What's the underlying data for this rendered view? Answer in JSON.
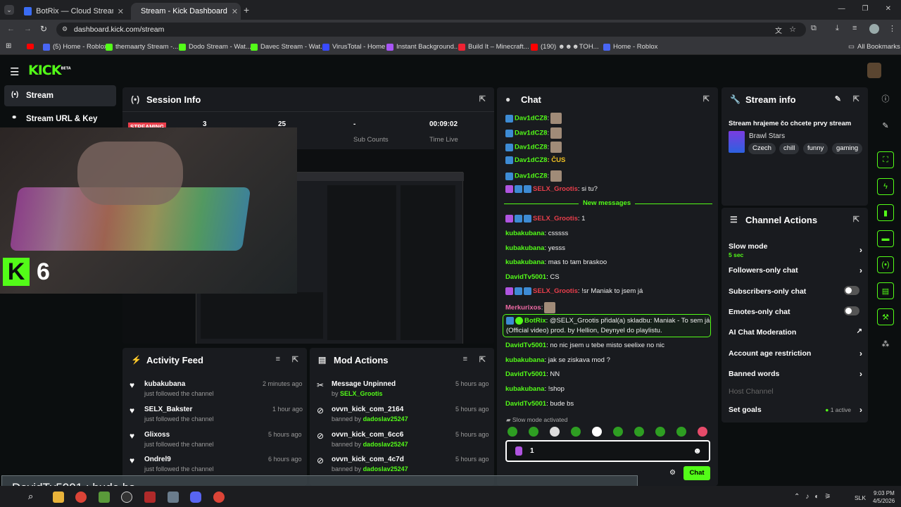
{
  "browser": {
    "tabs": [
      {
        "title": "BotRix — Cloud Streaming Bo"
      },
      {
        "title": "Stream - Kick Dashboard"
      }
    ],
    "url": "dashboard.kick.com/stream",
    "bookmarks": [
      "(5) Home - Roblox",
      "themaarty Stream -...",
      "Dodo Stream - Wat...",
      "Davec Stream - Wat...",
      "VirusTotal - Home",
      "Instant Background...",
      "Build It – Minecraft...",
      "(190) ☻☻☻TOH...",
      "Home - Roblox"
    ],
    "all_bookmarks": "All Bookmarks"
  },
  "brand": {
    "logo": "KICK",
    "beta": "BETA"
  },
  "nav": {
    "stream": "Stream",
    "stream_url_key": "Stream URL & Key"
  },
  "session": {
    "title": "Session Info",
    "status": "STREAMING",
    "viewers": "3",
    "followers_value": "25",
    "followers_label": "wers",
    "sub_value": "-",
    "sub_label": "Sub Counts",
    "time_value": "00:09:02",
    "time_label": "Time Live"
  },
  "overlay": {
    "counter": "6"
  },
  "activity": {
    "title": "Activity Feed",
    "items": [
      {
        "name": "kubakubana",
        "sub": "just followed the channel",
        "time": "2 minutes ago"
      },
      {
        "name": "SELX_Bakster",
        "sub": "just followed the channel",
        "time": "1 hour ago"
      },
      {
        "name": "Glixoss",
        "sub": "just followed the channel",
        "time": "5 hours ago"
      },
      {
        "name": "Ondrel9",
        "sub": "just followed the channel",
        "time": "6 hours ago"
      }
    ]
  },
  "mod": {
    "title": "Mod Actions",
    "items": [
      {
        "name": "Message Unpinned",
        "by": "by",
        "user": "SELX_Grootis",
        "time": "5 hours ago"
      },
      {
        "name": "ovvn_kick_com_2164",
        "by": "banned by",
        "user": "dadoslav25247",
        "time": "5 hours ago"
      },
      {
        "name": "ovvn_kick_com_6cc6",
        "by": "banned by",
        "user": "dadoslav25247",
        "time": "5 hours ago"
      },
      {
        "name": "ovvn_kick_com_4c7d",
        "by": "banned by",
        "user": "dadoslav25247",
        "time": "5 hours ago"
      }
    ]
  },
  "chat": {
    "title": "Chat",
    "messages": [
      {
        "user": "Dav1dCZ8",
        "text": ":",
        "color": "green"
      },
      {
        "user": "Dav1dCZ8",
        "text": ":",
        "color": "green"
      },
      {
        "user": "Dav1dCZ8",
        "text": ":",
        "color": "green"
      },
      {
        "user": "Dav1dCZ8",
        "text": ": ČUS",
        "color": "green"
      },
      {
        "user": "Dav1dCZ8",
        "text": ":",
        "color": "green"
      },
      {
        "user": "SELX_Grootis",
        "text": ": si tu?",
        "color": "red"
      }
    ],
    "new_messages": "New messages",
    "messages2": [
      {
        "user": "SELX_Grootis",
        "text": ": 1",
        "color": "red"
      },
      {
        "user": "kubakubana",
        "text": ": csssss",
        "color": "green"
      },
      {
        "user": "kubakubana",
        "text": ": yesss",
        "color": "green"
      },
      {
        "user": "kubakubana",
        "text": ": mas to tam braskoo",
        "color": "green"
      },
      {
        "user": "DavidTv5001",
        "text": ": CS",
        "color": "green"
      },
      {
        "user": "SELX_Grootis",
        "text": ": !sr Maniak to jsem já",
        "color": "red"
      },
      {
        "user": "Merkurixos",
        "text": ":",
        "color": "pink"
      }
    ],
    "bot": {
      "user": "BotRix",
      "line1": ": @SELX_Grootis přidal(a) skladbu: Maniak - To sem já",
      "line2": "(Official video) prod. by Hellion, Deynyel do playlistu."
    },
    "messages3": [
      {
        "user": "DavidTv5001",
        "text": ": no nic jsem u tebe misto seelixe no nic"
      },
      {
        "user": "kubakubana",
        "text": ": jak se ziskava mod ?"
      },
      {
        "user": "DavidTv5001",
        "text": ": NN"
      },
      {
        "user": "kubakubana",
        "text": ": !shop"
      },
      {
        "user": "DavidTv5001",
        "text": ": bude bs"
      }
    ],
    "slow_mode": "Slow mode activated",
    "input_value": "1",
    "send": "Chat"
  },
  "stream_info": {
    "title": "Stream info",
    "stream_title": "Stream hrajeme čo chcete prvy stream",
    "category": "Brawl Stars",
    "tags": [
      "Czech",
      "chill",
      "funny",
      "gaming"
    ]
  },
  "channel_actions": {
    "title": "Channel Actions",
    "slow_mode": "Slow mode",
    "slow_value": "5 sec",
    "followers_only": "Followers-only chat",
    "subscribers_only": "Subscribers-only chat",
    "emotes_only": "Emotes-only chat",
    "ai_mod": "AI Chat Moderation",
    "account_age": "Account age restriction",
    "banned_words": "Banned words",
    "host": "Host Channel",
    "goals": "Set goals",
    "goals_active": "1 active"
  },
  "obs_overlay": {
    "text": "DavidTv5001 : bude bs"
  },
  "taskbar": {
    "lang": "SLK",
    "time": "9:03 PM",
    "date": "4/5/2026"
  },
  "colors": {
    "accent": "#53fc18",
    "panel": "#191b1f",
    "bg": "#0b0e0f",
    "red": "#e93e4b"
  }
}
